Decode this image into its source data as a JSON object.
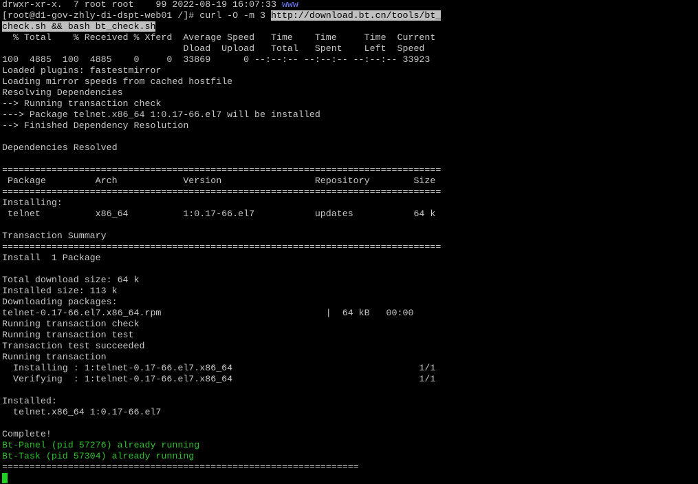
{
  "terminal": {
    "lines": [
      {
        "parts": [
          {
            "text": "drwxr-xr-x.  7 root root    99 2022-08-19 16:07:33 "
          },
          {
            "text": "www",
            "style": "blue"
          }
        ]
      },
      {
        "parts": [
          {
            "text": "[root@d1-gov-zhly-di-dspt-web01 /]# curl -O -m 3 "
          },
          {
            "text": "http://download.bt.cn/tools/bt_",
            "style": "sel"
          }
        ]
      },
      {
        "parts": [
          {
            "text": "check.sh && bash bt_check.sh",
            "style": "sel"
          }
        ]
      },
      {
        "parts": [
          {
            "text": "  % Total    % Received % Xferd  Average Speed   Time    Time     Time  Current"
          }
        ]
      },
      {
        "parts": [
          {
            "text": "                                 Dload  Upload   Total   Spent    Left  Speed"
          }
        ]
      },
      {
        "parts": [
          {
            "text": "100  4885  100  4885    0     0  33869      0 --:--:-- --:--:-- --:--:-- 33923"
          }
        ]
      },
      {
        "parts": [
          {
            "text": "Loaded plugins: fastestmirror"
          }
        ]
      },
      {
        "parts": [
          {
            "text": "Loading mirror speeds from cached hostfile"
          }
        ]
      },
      {
        "parts": [
          {
            "text": "Resolving Dependencies"
          }
        ]
      },
      {
        "parts": [
          {
            "text": "--> Running transaction check"
          }
        ]
      },
      {
        "parts": [
          {
            "text": "---> Package telnet.x86_64 1:0.17-66.el7 will be installed"
          }
        ]
      },
      {
        "parts": [
          {
            "text": "--> Finished Dependency Resolution"
          }
        ]
      },
      {
        "parts": [
          {
            "text": ""
          }
        ]
      },
      {
        "parts": [
          {
            "text": "Dependencies Resolved"
          }
        ]
      },
      {
        "parts": [
          {
            "text": ""
          }
        ]
      },
      {
        "parts": [
          {
            "text": "================================================================================"
          }
        ]
      },
      {
        "parts": [
          {
            "text": " Package         Arch            Version                 Repository        Size"
          }
        ]
      },
      {
        "parts": [
          {
            "text": "================================================================================"
          }
        ]
      },
      {
        "parts": [
          {
            "text": "Installing:"
          }
        ]
      },
      {
        "parts": [
          {
            "text": " telnet          x86_64          1:0.17-66.el7           updates           64 k"
          }
        ]
      },
      {
        "parts": [
          {
            "text": ""
          }
        ]
      },
      {
        "parts": [
          {
            "text": "Transaction Summary"
          }
        ]
      },
      {
        "parts": [
          {
            "text": "================================================================================"
          }
        ]
      },
      {
        "parts": [
          {
            "text": "Install  1 Package"
          }
        ]
      },
      {
        "parts": [
          {
            "text": ""
          }
        ]
      },
      {
        "parts": [
          {
            "text": "Total download size: 64 k"
          }
        ]
      },
      {
        "parts": [
          {
            "text": "Installed size: 113 k"
          }
        ]
      },
      {
        "parts": [
          {
            "text": "Downloading packages:"
          }
        ]
      },
      {
        "parts": [
          {
            "text": "telnet-0.17-66.el7.x86_64.rpm                              |  64 kB   00:00"
          }
        ]
      },
      {
        "parts": [
          {
            "text": "Running transaction check"
          }
        ]
      },
      {
        "parts": [
          {
            "text": "Running transaction test"
          }
        ]
      },
      {
        "parts": [
          {
            "text": "Transaction test succeeded"
          }
        ]
      },
      {
        "parts": [
          {
            "text": "Running transaction"
          }
        ]
      },
      {
        "parts": [
          {
            "text": "  Installing : 1:telnet-0.17-66.el7.x86_64                                  1/1"
          }
        ]
      },
      {
        "parts": [
          {
            "text": "  Verifying  : 1:telnet-0.17-66.el7.x86_64                                  1/1"
          }
        ]
      },
      {
        "parts": [
          {
            "text": ""
          }
        ]
      },
      {
        "parts": [
          {
            "text": "Installed:"
          }
        ]
      },
      {
        "parts": [
          {
            "text": "  telnet.x86_64 1:0.17-66.el7"
          }
        ]
      },
      {
        "parts": [
          {
            "text": ""
          }
        ]
      },
      {
        "parts": [
          {
            "text": "Complete!"
          }
        ]
      },
      {
        "parts": [
          {
            "text": "Bt-Panel (pid 57276) already running",
            "style": "green"
          }
        ]
      },
      {
        "parts": [
          {
            "text": "Bt-Task (pid 57304) already running",
            "style": "green"
          }
        ]
      },
      {
        "parts": [
          {
            "text": "================================================================="
          }
        ]
      }
    ]
  },
  "colors": {
    "background": "#000000",
    "text": "#c8c8c8",
    "blue": "#6f7dff",
    "green": "#2fbf2f",
    "selection": "#c0c0c0",
    "cursor": "#1fd01f"
  }
}
